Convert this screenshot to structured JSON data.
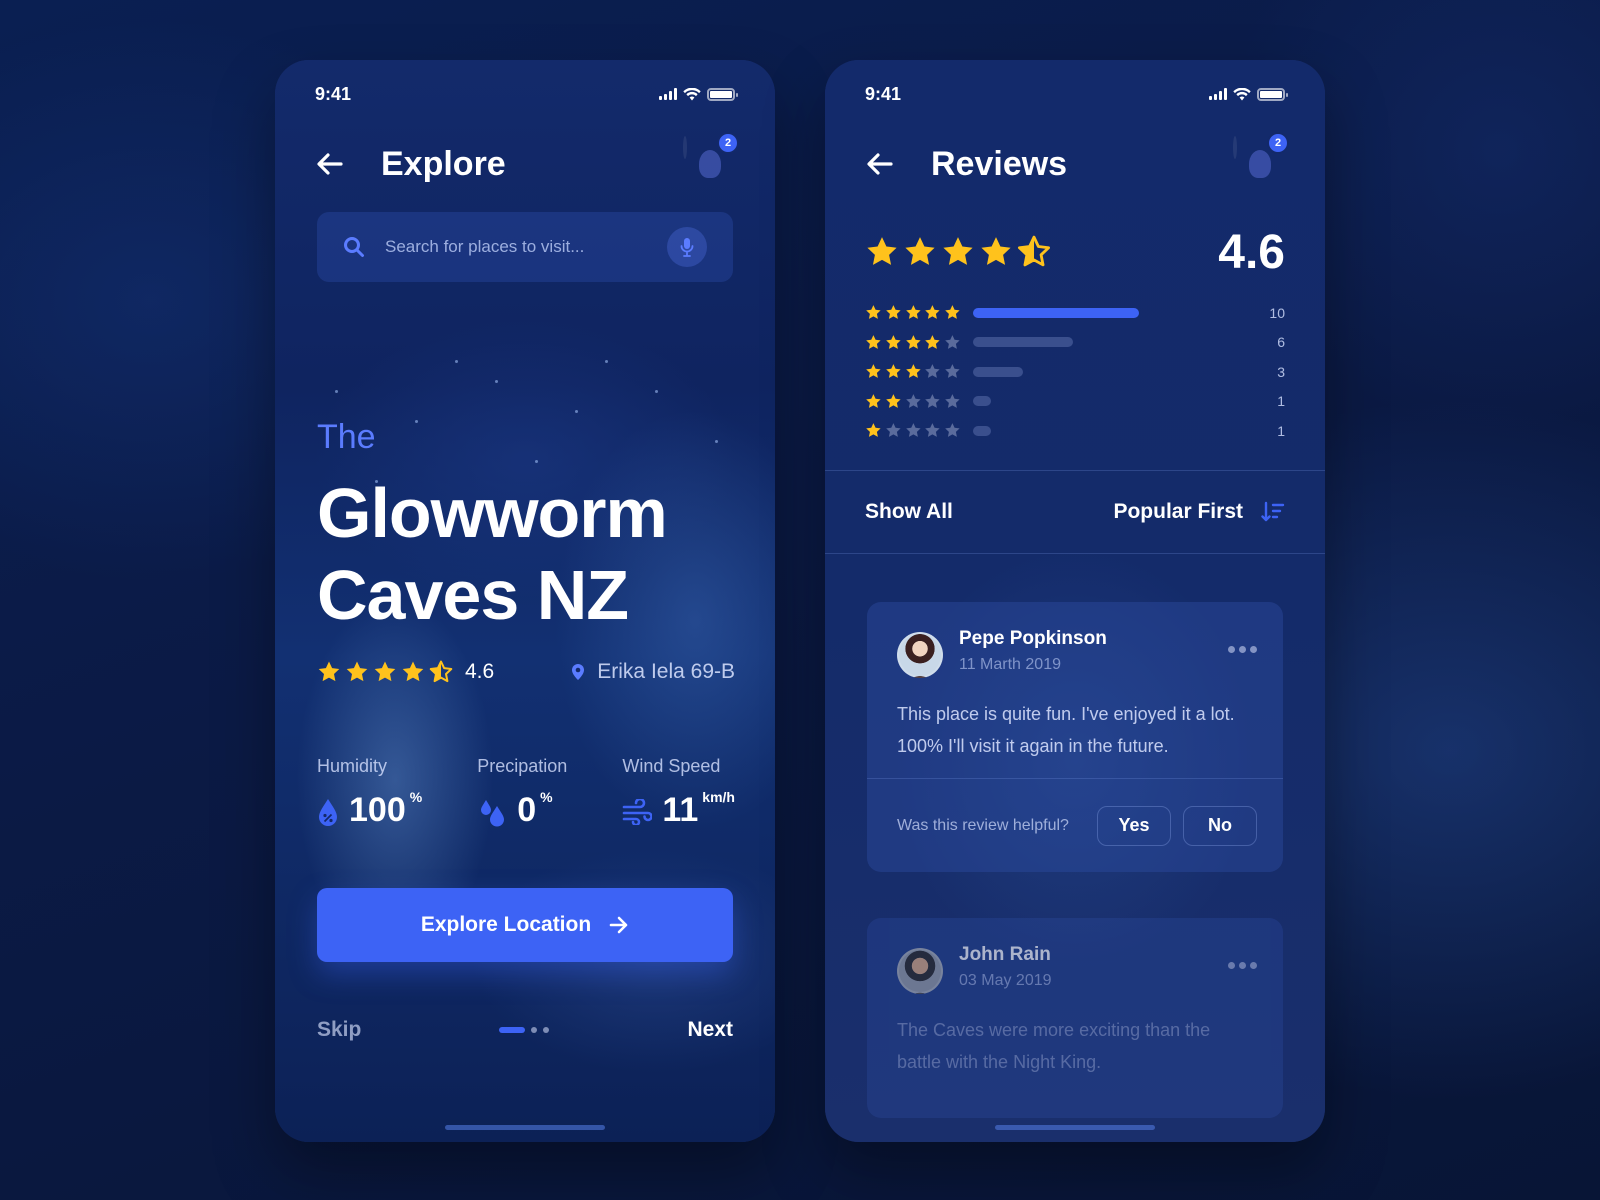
{
  "explore": {
    "status_time": "9:41",
    "title": "Explore",
    "badge_count": "2",
    "search_placeholder": "Search for places to visit...",
    "hero_prefix": "The",
    "hero_title_line1": "Glowworm",
    "hero_title_line2": "Caves NZ",
    "rating": "4.6",
    "rating_stars": 4.5,
    "location": "Erika Iela 69-B",
    "weather": [
      {
        "label": "Humidity",
        "value": "100",
        "unit": "%",
        "icon": "humidity-drop-icon"
      },
      {
        "label": "Precipation",
        "value": "0",
        "unit": "%",
        "icon": "rain-drops-icon"
      },
      {
        "label": "Wind Speed",
        "value": "11",
        "unit": "km/h",
        "icon": "wind-icon"
      }
    ],
    "cta_label": "Explore Location",
    "skip_label": "Skip",
    "next_label": "Next",
    "pager": {
      "total": 3,
      "active": 1
    }
  },
  "reviews": {
    "status_time": "9:41",
    "title": "Reviews",
    "badge_count": "2",
    "rating": "4.6",
    "rating_stars": 4.5,
    "distribution": [
      {
        "stars": 5,
        "count": "10"
      },
      {
        "stars": 4,
        "count": "6"
      },
      {
        "stars": 3,
        "count": "3"
      },
      {
        "stars": 2,
        "count": "1"
      },
      {
        "stars": 1,
        "count": "1"
      }
    ],
    "show_all_label": "Show All",
    "sort_label": "Popular First",
    "items": [
      {
        "name": "Pepe Popkinson",
        "date": "11 Marth 2019",
        "text": "This place is quite fun. I've enjoyed it a lot. 100% I'll visit it again in the future.",
        "helpful_prompt": "Was this review helpful?",
        "yes_label": "Yes",
        "no_label": "No"
      },
      {
        "name": "John Rain",
        "date": "03 May 2019",
        "text": "The Caves were more exciting than the battle with the Night King."
      }
    ]
  },
  "colors": {
    "accent": "#3d63f5",
    "star": "#ffc21c",
    "star_empty": "#5a6b9c",
    "background": "#0b1a45"
  }
}
